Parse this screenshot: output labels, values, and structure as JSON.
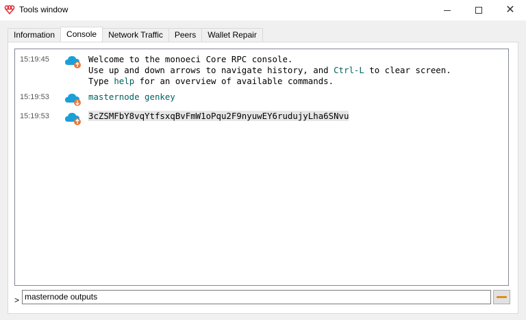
{
  "window": {
    "title": "Tools window",
    "logo_icon": "monoeci-logo-icon",
    "controls": [
      "minimize-icon",
      "maximize-icon",
      "close-icon"
    ]
  },
  "tabs": [
    {
      "label": "Information",
      "active": false
    },
    {
      "label": "Console",
      "active": true
    },
    {
      "label": "Network Traffic",
      "active": false
    },
    {
      "label": "Peers",
      "active": false
    },
    {
      "label": "Wallet Repair",
      "active": false
    }
  ],
  "console": {
    "messages": [
      {
        "time": "15:19:45",
        "icon": "cloud-reply-icon",
        "line1": "Welcome to the monoeci Core RPC console.",
        "line2_pre": "Use up and down arrows to navigate history, and ",
        "line2_hl": "Ctrl-L",
        "line2_post": " to clear screen.",
        "line3_pre": "Type ",
        "line3_hl": "help",
        "line3_post": " for an overview of available commands."
      },
      {
        "time": "15:19:53",
        "icon": "cloud-request-icon",
        "text": "masternode genkey"
      },
      {
        "time": "15:19:53",
        "icon": "cloud-reply-icon",
        "text": "3cZSMFbY8vqYtfsxqBvFmW1oPqu2F9nyuwEY6rudujyLha6SNvu"
      }
    ],
    "prompt": ">",
    "input_value": "masternode outputs",
    "clear_button_icon": "clear-console-icon"
  },
  "colors": {
    "accent_teal": "#006060",
    "cloud_blue": "#1aa0d8",
    "arrow_orange": "#e8753a",
    "clear_orange": "#e08a1e",
    "logo_red": "#e0303a"
  }
}
